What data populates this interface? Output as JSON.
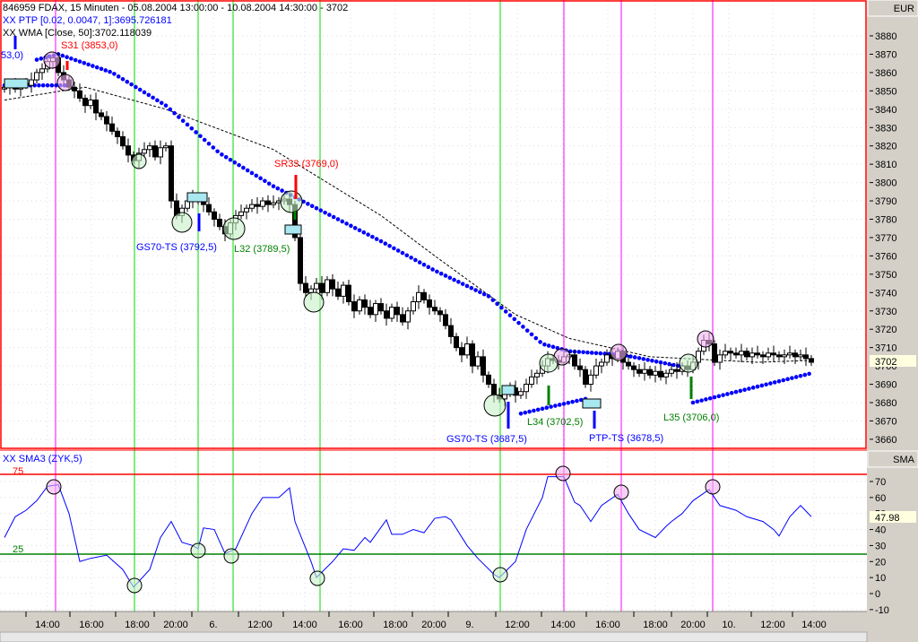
{
  "header": {
    "title": "846959  FDAX, 15 Minuten - 05.08.2004 13:00:00 - 10.08.2004 14:30:00 - 3702",
    "ptp": "XX PTP [0.02, 0.0047, 1]:3695.726181",
    "wma": "XX WMA [Close, 50]:3702.118039",
    "sma_label": "XX    SMA3 (ZYK,5)"
  },
  "axis": {
    "price_unit": "EUR",
    "sma_unit": "SMA",
    "price_current": "3702",
    "sma_current": "47.98"
  },
  "annotations": {
    "s31": "S31 (3853,0)",
    "cut": "53,0)",
    "sr33": "SR33 (3769,0)",
    "gs70a": "GS70-TS (3792,5)",
    "l32": "L32 (3789,5)",
    "gs70b": "GS70-TS (3687,5)",
    "l34": "L34 (3702,5)",
    "ptp_ts": "PTP-TS (3678,5)",
    "l35": "L35 (3706,0)",
    "lvl75": "75",
    "lvl25": "25"
  },
  "colors": {
    "up": "#ffffff",
    "down": "#000000",
    "ptp": "#0000ff",
    "sma": "#0000ff",
    "green": "#00dd00",
    "magenta": "#ff00ff",
    "red": "#ff0000"
  },
  "chart_data": [
    {
      "type": "candlestick",
      "title": "FDAX, 15 Minuten",
      "ylabel": "EUR",
      "ylim": [
        3655,
        3885
      ],
      "yticks": [
        3660,
        3670,
        3680,
        3690,
        3700,
        3710,
        3720,
        3730,
        3740,
        3750,
        3760,
        3770,
        3780,
        3790,
        3800,
        3810,
        3820,
        3830,
        3840,
        3850,
        3860,
        3870,
        3880
      ],
      "xticks": [
        "14:00",
        "16:00",
        "18:00",
        "20:00",
        "6.",
        "12:00",
        "14:00",
        "16:00",
        "18:00",
        "20:00",
        "9.",
        "12:00",
        "14:00",
        "16:00",
        "18:00",
        "20:00",
        "10.",
        "12:00",
        "14:00"
      ],
      "closes": [
        3852,
        3853,
        3851,
        3854,
        3853,
        3856,
        3860,
        3862,
        3866,
        3868,
        3860,
        3856,
        3852,
        3850,
        3846,
        3842,
        3845,
        3838,
        3836,
        3832,
        3828,
        3825,
        3820,
        3815,
        3812,
        3816,
        3818,
        3820,
        3814,
        3819,
        3820,
        3790,
        3782,
        3786,
        3790,
        3792,
        3790,
        3788,
        3784,
        3780,
        3776,
        3772,
        3778,
        3782,
        3784,
        3786,
        3788,
        3787,
        3790,
        3788,
        3789,
        3790,
        3791,
        3788,
        3770,
        3745,
        3740,
        3742,
        3745,
        3740,
        3747,
        3742,
        3738,
        3744,
        3735,
        3730,
        3736,
        3732,
        3728,
        3734,
        3730,
        3726,
        3732,
        3728,
        3724,
        3730,
        3735,
        3740,
        3736,
        3732,
        3730,
        3728,
        3722,
        3716,
        3710,
        3706,
        3712,
        3700,
        3705,
        3695,
        3690,
        3684,
        3682,
        3685,
        3688,
        3684,
        3686,
        3690,
        3694,
        3696,
        3700,
        3704,
        3703,
        3702,
        3705,
        3706,
        3700,
        3698,
        3690,
        3695,
        3700,
        3702,
        3706,
        3704,
        3708,
        3702,
        3700,
        3698,
        3696,
        3698,
        3695,
        3697,
        3694,
        3696,
        3698,
        3697,
        3700,
        3698,
        3702,
        3708,
        3714,
        3712,
        3702,
        3706,
        3708,
        3707,
        3706,
        3708,
        3705,
        3707,
        3706,
        3705,
        3707,
        3706,
        3705,
        3706,
        3707,
        3705,
        3706,
        3704,
        3702
      ],
      "ptp_upper": [
        [
          6,
          3867
        ],
        [
          10,
          3870
        ],
        [
          20,
          3860
        ],
        [
          30,
          3842
        ],
        [
          40,
          3816
        ],
        [
          50,
          3798
        ],
        [
          60,
          3783
        ],
        [
          70,
          3768
        ],
        [
          80,
          3752
        ],
        [
          90,
          3738
        ],
        [
          100,
          3712
        ],
        [
          105,
          3708
        ],
        [
          115,
          3706
        ],
        [
          127,
          3699
        ]
      ],
      "ptp_lower": [
        [
          0,
          3853
        ],
        [
          12,
          3853
        ],
        [
          96,
          3674
        ],
        [
          108,
          3682
        ],
        [
          128,
          3680
        ],
        [
          150,
          3696
        ]
      ],
      "wma": [
        [
          0,
          3845
        ],
        [
          15,
          3852
        ],
        [
          30,
          3840
        ],
        [
          50,
          3818
        ],
        [
          60,
          3800
        ],
        [
          70,
          3782
        ],
        [
          80,
          3760
        ],
        [
          95,
          3728
        ],
        [
          105,
          3715
        ],
        [
          120,
          3705
        ],
        [
          140,
          3702
        ],
        [
          150,
          3703
        ]
      ]
    },
    {
      "type": "line",
      "title": "SMA3 (ZYK,5)",
      "ylim": [
        -12,
        78
      ],
      "yticks": [
        -10,
        0,
        10,
        20,
        30,
        40,
        50,
        60,
        70
      ],
      "levels": [
        75,
        25
      ],
      "series": [
        {
          "name": "SMA3",
          "points": [
            [
              0,
              35
            ],
            [
              2,
              48
            ],
            [
              4,
              52
            ],
            [
              6,
              58
            ],
            [
              8,
              67
            ],
            [
              10,
              68
            ],
            [
              12,
              50
            ],
            [
              14,
              20
            ],
            [
              16,
              22
            ],
            [
              19,
              24
            ],
            [
              22,
              15
            ],
            [
              24,
              4
            ],
            [
              27,
              15
            ],
            [
              29,
              35
            ],
            [
              31,
              45
            ],
            [
              33,
              32
            ],
            [
              35,
              30
            ],
            [
              36,
              28
            ],
            [
              37,
              41
            ],
            [
              39,
              40
            ],
            [
              41,
              25
            ],
            [
              43,
              28
            ],
            [
              46,
              50
            ],
            [
              48,
              60
            ],
            [
              51,
              60
            ],
            [
              53,
              66
            ],
            [
              54,
              45
            ],
            [
              57,
              20
            ],
            [
              58,
              10
            ],
            [
              61,
              20
            ],
            [
              63,
              28
            ],
            [
              65,
              27
            ],
            [
              67,
              35
            ],
            [
              68,
              32
            ],
            [
              71,
              46
            ],
            [
              72,
              37
            ],
            [
              74,
              37
            ],
            [
              76,
              40
            ],
            [
              78,
              38
            ],
            [
              80,
              47
            ],
            [
              82,
              48
            ],
            [
              83,
              46
            ],
            [
              86,
              30
            ],
            [
              88,
              22
            ],
            [
              91,
              12
            ],
            [
              92,
              10
            ],
            [
              95,
              20
            ],
            [
              97,
              40
            ],
            [
              100,
              60
            ],
            [
              101,
              73
            ],
            [
              104,
              73
            ],
            [
              106,
              57
            ],
            [
              107,
              55
            ],
            [
              109,
              45
            ],
            [
              111,
              55
            ],
            [
              114,
              62
            ],
            [
              116,
              50
            ],
            [
              118,
              40
            ],
            [
              121,
              35
            ],
            [
              123,
              42
            ],
            [
              124,
              45
            ],
            [
              126,
              50
            ],
            [
              128,
              58
            ],
            [
              131,
              65
            ],
            [
              133,
              55
            ],
            [
              136,
              52
            ],
            [
              138,
              48
            ],
            [
              141,
              45
            ],
            [
              143,
              40
            ],
            [
              144,
              36
            ],
            [
              146,
              48
            ],
            [
              148,
              55
            ],
            [
              150,
              48
            ]
          ]
        }
      ]
    }
  ]
}
